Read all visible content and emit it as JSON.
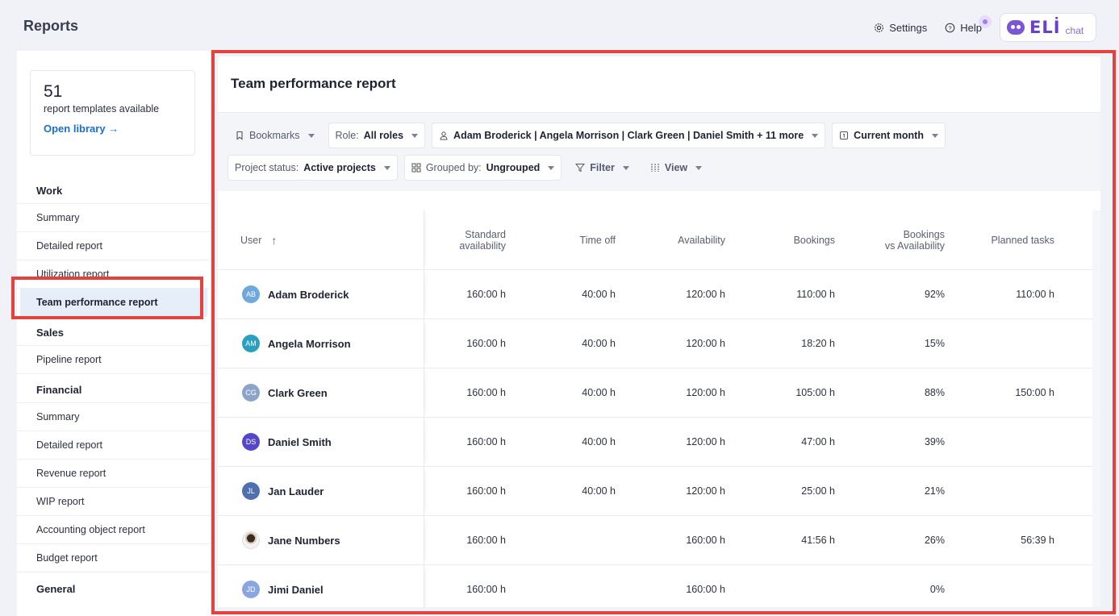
{
  "app": {
    "title": "Reports"
  },
  "top_actions": {
    "settings": "Settings",
    "help": "Help",
    "eli_logo": "ELİ",
    "eli_chat": "chat"
  },
  "sidebar": {
    "library": {
      "count": "51",
      "text": "report templates available",
      "link": "Open library →"
    },
    "sections": [
      {
        "title": "Work",
        "items": [
          "Summary",
          "Detailed report",
          "Utilization report",
          "Team performance report"
        ]
      },
      {
        "title": "Sales",
        "items": [
          "Pipeline report"
        ]
      },
      {
        "title": "Financial",
        "items": [
          "Summary",
          "Detailed report",
          "Revenue report",
          "WIP report",
          "Accounting object report",
          "Budget report"
        ]
      },
      {
        "title": "General",
        "items": []
      }
    ],
    "active_item": "Team performance report"
  },
  "main": {
    "title": "Team performance report",
    "filters": {
      "bookmarks": "Bookmarks",
      "role_label": "Role:",
      "role_value": "All roles",
      "people": "Adam Broderick | Angela Morrison | Clark Green | Daniel Smith + 11 more",
      "period": "Current month",
      "status_label": "Project status:",
      "status_value": "Active projects",
      "group_label": "Grouped by:",
      "group_value": "Ungrouped",
      "filter": "Filter",
      "view": "View"
    },
    "table": {
      "headers": {
        "user": "User",
        "standard": [
          "Standard",
          "availability"
        ],
        "time_off": "Time off",
        "availability": "Availability",
        "bookings": "Bookings",
        "bva": [
          "Bookings",
          "vs Availability"
        ],
        "planned": "Planned tasks"
      },
      "rows": [
        {
          "initials": "AB",
          "color": "#6fa8dc",
          "name": "Adam Broderick",
          "standard": "160:00 h",
          "time_off": "40:00 h",
          "availability": "120:00 h",
          "bookings": "110:00 h",
          "bva": "92%",
          "planned": "110:00 h"
        },
        {
          "initials": "AM",
          "color": "#2a9fbf",
          "name": "Angela Morrison",
          "standard": "160:00 h",
          "time_off": "40:00 h",
          "availability": "120:00 h",
          "bookings": "18:20 h",
          "bva": "15%",
          "planned": ""
        },
        {
          "initials": "CG",
          "color": "#8ea3c9",
          "name": "Clark Green",
          "standard": "160:00 h",
          "time_off": "40:00 h",
          "availability": "120:00 h",
          "bookings": "105:00 h",
          "bva": "88%",
          "planned": "150:00 h"
        },
        {
          "initials": "DS",
          "color": "#5548c8",
          "name": "Daniel Smith",
          "standard": "160:00 h",
          "time_off": "40:00 h",
          "availability": "120:00 h",
          "bookings": "47:00 h",
          "bva": "39%",
          "planned": ""
        },
        {
          "initials": "JL",
          "color": "#4f6fae",
          "name": "Jan Lauder",
          "standard": "160:00 h",
          "time_off": "40:00 h",
          "availability": "120:00 h",
          "bookings": "25:00 h",
          "bva": "21%",
          "planned": ""
        },
        {
          "initials": "",
          "color": "photo",
          "name": "Jane Numbers",
          "standard": "160:00 h",
          "time_off": "",
          "availability": "160:00 h",
          "bookings": "41:56 h",
          "bva": "26%",
          "planned": "56:39 h"
        },
        {
          "initials": "JD",
          "color": "#8aa6e0",
          "name": "Jimi Daniel",
          "standard": "160:00 h",
          "time_off": "",
          "availability": "160:00 h",
          "bookings": "",
          "bva": "0%",
          "planned": ""
        }
      ]
    }
  },
  "colors": {
    "highlight": "#e4423d",
    "link": "#1a6fd0",
    "active_bg": "#e6eff9"
  }
}
